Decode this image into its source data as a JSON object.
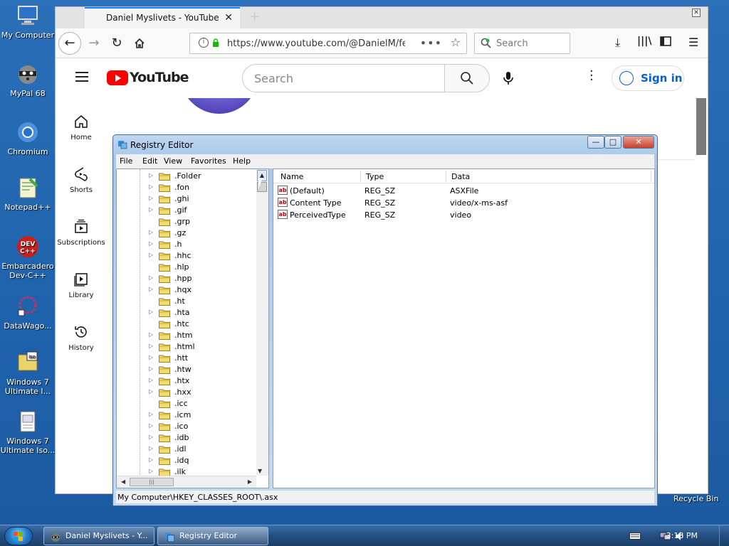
{
  "desktop": {
    "icons": [
      {
        "label": "My Computer",
        "icon": "computer-icon"
      },
      {
        "label": "MyPal 68",
        "icon": "mypal-raccoon-icon"
      },
      {
        "label": "Chromium",
        "icon": "chromium-icon"
      },
      {
        "label": "Notepad++",
        "icon": "notepadpp-icon"
      },
      {
        "label": "Embarcadero Dev-C++",
        "icon": "devcpp-icon"
      },
      {
        "label": "DataWago...",
        "icon": "datawago-icon"
      },
      {
        "label": "Windows 7 Ultimate I...",
        "icon": "iso-file-icon"
      },
      {
        "label": "Windows 7 Ultimate Iso...",
        "icon": "document-icon"
      }
    ],
    "recycle_bin": "Recycle Bin"
  },
  "taskbar": {
    "buttons": [
      {
        "label": "Daniel Myslivets - Y..."
      },
      {
        "label": "Registry Editor"
      }
    ],
    "clock": "3:13 PM"
  },
  "browser": {
    "tab_title": "Daniel Myslivets - YouTube",
    "url": "https://www.youtube.com/@DanielM/featu",
    "search_placeholder": "Search"
  },
  "youtube": {
    "logo_text": "YouTube",
    "search_placeholder": "Search",
    "sign_in": "Sign in",
    "sidebar": [
      {
        "label": "Home",
        "icon": "home-icon"
      },
      {
        "label": "Shorts",
        "icon": "shorts-icon"
      },
      {
        "label": "Subscriptions",
        "icon": "subscriptions-icon"
      },
      {
        "label": "Library",
        "icon": "library-icon"
      },
      {
        "label": "History",
        "icon": "history-icon"
      }
    ]
  },
  "regedit": {
    "title": "Registry Editor",
    "menu": [
      "File",
      "Edit",
      "View",
      "Favorites",
      "Help"
    ],
    "tree": [
      {
        "name": ".Folder",
        "expandable": true
      },
      {
        "name": ".fon",
        "expandable": true
      },
      {
        "name": ".ghi",
        "expandable": true
      },
      {
        "name": ".gif",
        "expandable": true
      },
      {
        "name": ".grp",
        "expandable": false
      },
      {
        "name": ".gz",
        "expandable": true
      },
      {
        "name": ".h",
        "expandable": true
      },
      {
        "name": ".hhc",
        "expandable": true
      },
      {
        "name": ".hlp",
        "expandable": false
      },
      {
        "name": ".hpp",
        "expandable": true
      },
      {
        "name": ".hqx",
        "expandable": true
      },
      {
        "name": ".ht",
        "expandable": false
      },
      {
        "name": ".hta",
        "expandable": true
      },
      {
        "name": ".htc",
        "expandable": false
      },
      {
        "name": ".htm",
        "expandable": true
      },
      {
        "name": ".html",
        "expandable": true
      },
      {
        "name": ".htt",
        "expandable": true
      },
      {
        "name": ".htw",
        "expandable": true
      },
      {
        "name": ".htx",
        "expandable": true
      },
      {
        "name": ".hxx",
        "expandable": true
      },
      {
        "name": ".icc",
        "expandable": false
      },
      {
        "name": ".icm",
        "expandable": true
      },
      {
        "name": ".ico",
        "expandable": true
      },
      {
        "name": ".idb",
        "expandable": true
      },
      {
        "name": ".idl",
        "expandable": true
      },
      {
        "name": ".idq",
        "expandable": true
      },
      {
        "name": ".ilk",
        "expandable": true
      }
    ],
    "columns": {
      "name": "Name",
      "type": "Type",
      "data": "Data"
    },
    "values": [
      {
        "name": "(Default)",
        "type": "REG_SZ",
        "data": "ASXFile"
      },
      {
        "name": "Content Type",
        "type": "REG_SZ",
        "data": "video/x-ms-asf"
      },
      {
        "name": "PerceivedType",
        "type": "REG_SZ",
        "data": "video"
      }
    ],
    "status_path": "My Computer\\HKEY_CLASSES_ROOT\\.asx"
  }
}
